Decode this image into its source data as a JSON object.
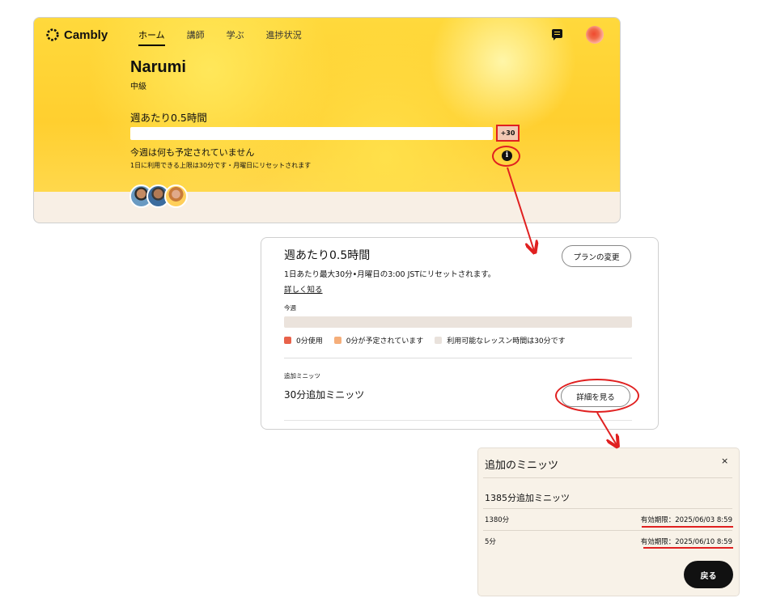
{
  "app": {
    "brand": "Cambly",
    "nav": [
      "ホーム",
      "講師",
      "学ぶ",
      "進捗状況"
    ],
    "user_name": "Narumi",
    "level": "中級",
    "weekly_title": "週あたり0.5時間",
    "plus_button": "+30",
    "no_schedule": "今週は何も予定されていません",
    "limit_note": "1日に利用できる上限は30分です・月曜日にリセットされます",
    "info_icon": "i"
  },
  "panel": {
    "title": "週あたり0.5時間",
    "plan_button": "プランの変更",
    "reset_text": "1日あたり最大30分•月曜日の3:00 JSTにリセットされます。",
    "learn_more": "詳しく知る",
    "week_label": "今週",
    "weekly_fill": 0,
    "legend": [
      {
        "label": "0分使用",
        "color": "#e8624a"
      },
      {
        "label": "0分が予定されています",
        "color": "#f5ae7a"
      },
      {
        "label": "利用可能なレッスン時間は30分です",
        "color": "#e9e2dc"
      }
    ],
    "extra_label": "追加ミニッツ",
    "extra_value": "30分追加ミニッツ",
    "details_button": "詳細を見る"
  },
  "modal": {
    "title": "追加のミニッツ",
    "close": "×",
    "total": "1385分追加ミニッツ",
    "rows": [
      {
        "minutes": "1380分",
        "expiry": "有効期限：2025/06/03 8:59"
      },
      {
        "minutes": "5分",
        "expiry": "有効期限：2025/06/10 8:59"
      }
    ],
    "back_button": "戻る"
  },
  "colors": {
    "accent_red": "#e02020",
    "hero_yellow": "#ffd93c"
  }
}
